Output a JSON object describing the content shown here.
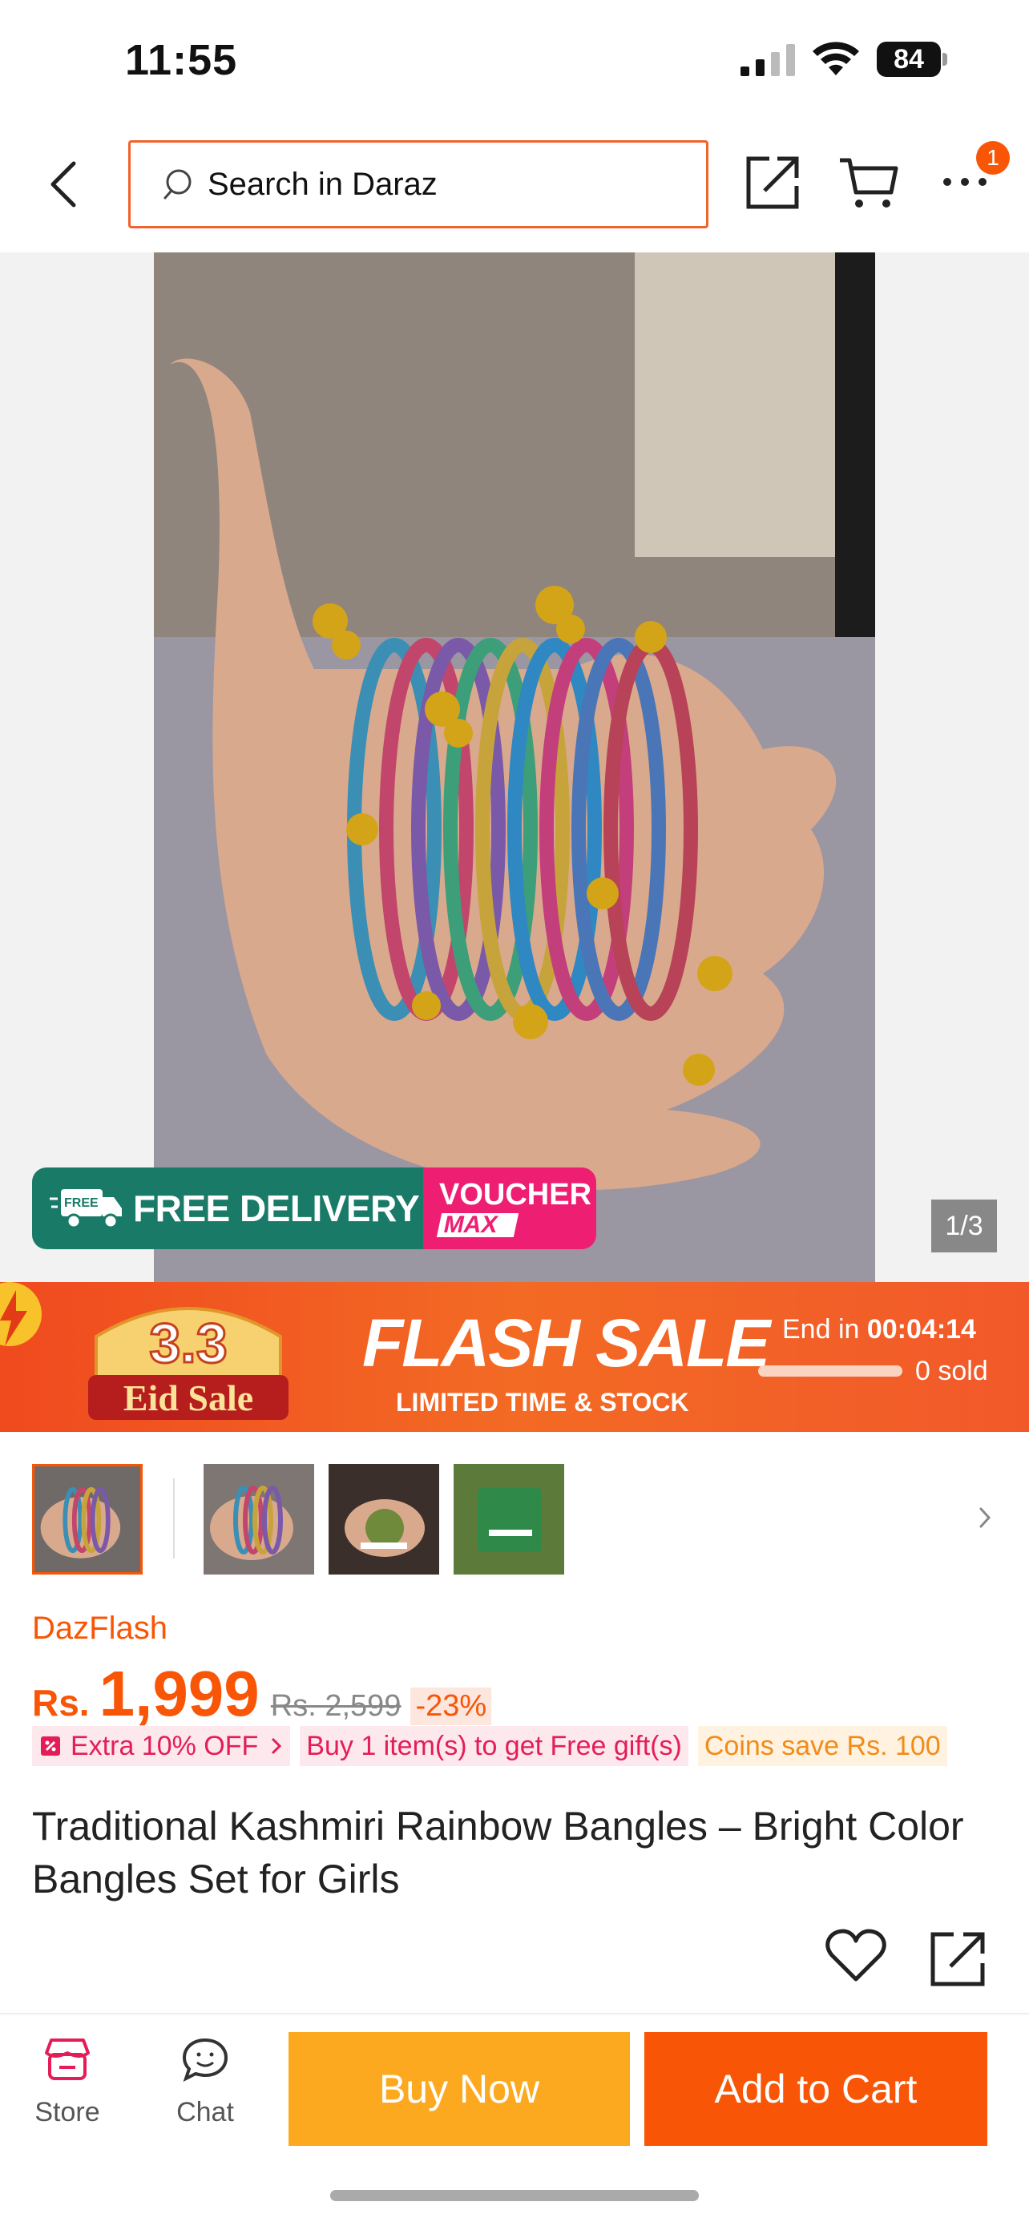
{
  "status_bar": {
    "time": "11:55",
    "battery": "84"
  },
  "header": {
    "search_placeholder": "Search in Daraz",
    "notification_count": "1"
  },
  "hero": {
    "free_delivery_label": "FREE DELIVERY",
    "free_word": "FREE",
    "voucher_line1": "VOUCHER",
    "voucher_line2": "MAX",
    "image_counter": "1/3"
  },
  "flash_sale": {
    "badge_top": "3.3",
    "badge_bottom": "Eid Sale",
    "title": "FLASH SALE",
    "subtitle": "LIMITED TIME & STOCK",
    "end_label": "End in",
    "countdown": "00:04:14",
    "sold": "0 sold"
  },
  "product": {
    "store": "DazFlash",
    "currency": "Rs.",
    "price": "1,999",
    "old_price": "Rs. 2,599",
    "discount": "-23%",
    "tags": {
      "extra": "Extra 10% OFF",
      "gift": "Buy 1 item(s) to get Free gift(s)",
      "coins": "Coins save Rs. 100"
    },
    "title": "Traditional Kashmiri Rainbow Bangles – Bright Color Bangles Set for Girls"
  },
  "bottom_bar": {
    "store_label": "Store",
    "chat_label": "Chat",
    "buy_now": "Buy Now",
    "add_to_cart": "Add to Cart"
  },
  "colors": {
    "accent": "#f85606",
    "buy_now": "#fda920",
    "pink": "#e41d58",
    "green": "#197a67"
  }
}
